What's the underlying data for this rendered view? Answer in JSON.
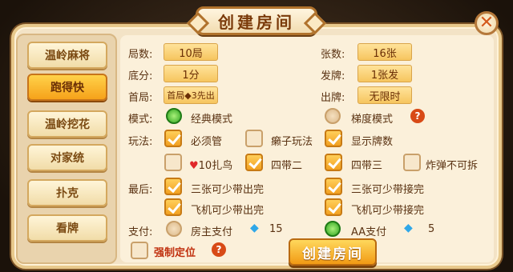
{
  "title": "创建房间",
  "close_icon": "close-x",
  "sidebar": {
    "items": [
      {
        "label": "温岭麻将",
        "active": false
      },
      {
        "label": "跑得快",
        "active": true
      },
      {
        "label": "温岭挖花",
        "active": false
      },
      {
        "label": "对家统",
        "active": false
      },
      {
        "label": "扑克",
        "active": false
      },
      {
        "label": "看牌",
        "active": false
      }
    ]
  },
  "settings": {
    "rounds_label": "局数:",
    "rounds_value": "10局",
    "cards_label": "张数:",
    "cards_value": "16张",
    "base_label": "底分:",
    "base_value": "1分",
    "deal_label": "发牌:",
    "deal_value": "1张发",
    "first_label": "首局:",
    "first_value": "首局◆3先出",
    "play_label": "出牌:",
    "play_value": "无限时"
  },
  "mode": {
    "label": "模式:",
    "classic": "经典模式",
    "classic_selected": true,
    "ladder": "梯度模式",
    "ladder_selected": false
  },
  "rules": {
    "label": "玩法:",
    "must_play": "必须管",
    "must_play_checked": true,
    "lazy": "癞子玩法",
    "lazy_checked": false,
    "show_count": "显示牌数",
    "show_count_checked": true,
    "heart_ten": "10扎鸟",
    "heart_ten_checked": false,
    "four_two": "四带二",
    "four_two_checked": true,
    "four_three": "四带三",
    "four_three_checked": true,
    "bomb_split": "炸弹不可拆",
    "bomb_split_checked": false
  },
  "last": {
    "label": "最后:",
    "three_out": "三张可少带出完",
    "three_out_checked": true,
    "three_in": "三张可少带接完",
    "three_in_checked": true,
    "plane_out": "飞机可少带出完",
    "plane_out_checked": true,
    "plane_in": "飞机可少带接完",
    "plane_in_checked": true
  },
  "payment": {
    "label": "支付:",
    "host": "房主支付",
    "host_selected": false,
    "host_cost": "15",
    "aa": "AA支付",
    "aa_selected": true,
    "aa_cost": "5"
  },
  "force_location": {
    "label": "强制定位",
    "checked": false
  },
  "create_button": "创建房间",
  "colors": {
    "accent": "#f6a21a",
    "panel": "#f3e3c6",
    "red_text": "#c0300e"
  }
}
